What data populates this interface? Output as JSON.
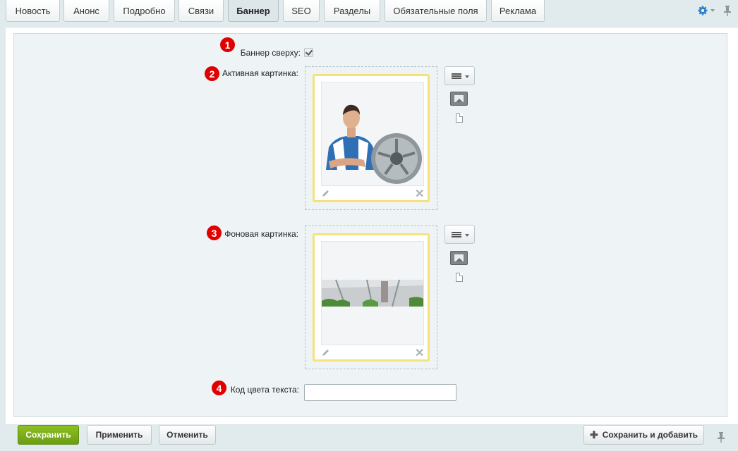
{
  "tabs": [
    {
      "label": "Новость",
      "active": false
    },
    {
      "label": "Анонс",
      "active": false
    },
    {
      "label": "Подробно",
      "active": false
    },
    {
      "label": "Связи",
      "active": false
    },
    {
      "label": "Баннер",
      "active": true
    },
    {
      "label": "SEO",
      "active": false
    },
    {
      "label": "Разделы",
      "active": false
    },
    {
      "label": "Обязательные поля",
      "active": false
    },
    {
      "label": "Реклама",
      "active": false
    }
  ],
  "toolbar": {
    "settings_icon": "gear-icon",
    "pin_icon": "pin-icon"
  },
  "form": {
    "banner_top": {
      "badge": "1",
      "label": "Баннер сверху:",
      "checked": true
    },
    "active_image": {
      "badge": "2",
      "label": "Активная картинка:"
    },
    "background_image": {
      "badge": "3",
      "label": "Фоновая картинка:"
    },
    "text_color": {
      "badge": "4",
      "label": "Код цвета текста:",
      "value": ""
    }
  },
  "buttons": {
    "save": "Сохранить",
    "apply": "Применить",
    "cancel": "Отменить",
    "save_add": "Сохранить и добавить"
  },
  "colors": {
    "accent_green": "#7aad18",
    "badge_red": "#e00000",
    "frame_yellow": "#f6e27a",
    "panel_bg": "#eef3f5"
  }
}
